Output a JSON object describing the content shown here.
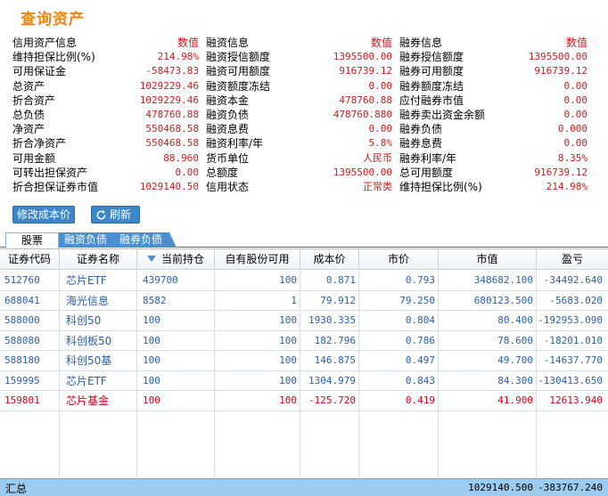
{
  "title": "查询资产",
  "info": {
    "rows": [
      [
        [
          "信用资产信息",
          "数值"
        ],
        [
          "融资信息",
          "数值"
        ],
        [
          "融券信息",
          "数值"
        ]
      ],
      [
        [
          "维持担保比例(%)",
          "214.98%"
        ],
        [
          "融资授信额度",
          "1395500.00"
        ],
        [
          "融券授信额度",
          "1395500.00"
        ]
      ],
      [
        [
          "可用保证金",
          "-58473.83"
        ],
        [
          "融资可用额度",
          "916739.12"
        ],
        [
          "融券可用额度",
          "916739.12"
        ]
      ],
      [
        [
          "总资产",
          "1029229.46"
        ],
        [
          "融资额度冻结",
          "0.00"
        ],
        [
          "融券额度冻结",
          "0.00"
        ]
      ],
      [
        [
          "折合资产",
          "1029229.46"
        ],
        [
          "融资本金",
          "478760.88"
        ],
        [
          "应付融券市值",
          "0.00"
        ]
      ],
      [
        [
          "总负债",
          "478760.88"
        ],
        [
          "融资负债",
          "478760.880"
        ],
        [
          "融券卖出资金余额",
          "0.00"
        ]
      ],
      [
        [
          "净资产",
          "550468.58"
        ],
        [
          "融资息费",
          "0.00"
        ],
        [
          "融券负债",
          "0.000"
        ]
      ],
      [
        [
          "折合净资产",
          "550468.58"
        ],
        [
          "融资利率/年",
          "5.8%"
        ],
        [
          "融券息费",
          "0.00"
        ]
      ],
      [
        [
          "可用金额",
          "88.960"
        ],
        [
          "货币单位",
          "人民币"
        ],
        [
          "融券利率/年",
          "8.35%"
        ]
      ],
      [
        [
          "可转出担保资产",
          "0.00"
        ],
        [
          "总额度",
          "1395500.00"
        ],
        [
          "总可用额度",
          "916739.12"
        ]
      ],
      [
        [
          "折合担保证券市值",
          "1029140.50"
        ],
        [
          "信用状态",
          "正常类"
        ],
        [
          "维持担保比例(%)",
          "214.98%"
        ]
      ]
    ]
  },
  "buttons": {
    "edit_cost": "修改成本价",
    "refresh": "刷新"
  },
  "tabs": [
    "股票",
    "融资负债",
    "融券负债"
  ],
  "table": {
    "headers": [
      "证券代码",
      "证券名称",
      "当前持仓",
      "自有股份可用",
      "成本价",
      "市价",
      "市值",
      "盈亏"
    ],
    "rows": [
      [
        "512760",
        "芯片ETF",
        "439700",
        "100",
        "0.871",
        "0.793",
        "348682.100",
        "-34492.640"
      ],
      [
        "688041",
        "海光信息",
        "8582",
        "1",
        "79.912",
        "79.250",
        "680123.500",
        "-5683.020"
      ],
      [
        "588000",
        "科创50",
        "100",
        "100",
        "1930.335",
        "0.804",
        "80.400",
        "-192953.090"
      ],
      [
        "588080",
        "科创板50",
        "100",
        "100",
        "182.796",
        "0.786",
        "78.600",
        "-18201.010"
      ],
      [
        "588180",
        "科创50基",
        "100",
        "100",
        "146.875",
        "0.497",
        "49.700",
        "-14637.770"
      ],
      [
        "159995",
        "芯片ETF",
        "100",
        "100",
        "1304.979",
        "0.843",
        "84.300",
        "-130413.650"
      ],
      [
        "159801",
        "芯片基金",
        "100",
        "100",
        "-125.720",
        "0.419",
        "41.900",
        "12613.940"
      ]
    ],
    "red_row_index": 6
  },
  "total": {
    "label": "汇总",
    "market_value": "1029140.500",
    "pnl": "-383767.240"
  },
  "colors": {
    "title": "#f0840c",
    "value_red": "#c81e1e",
    "accent_blue": "#3d87c9",
    "row_text_blue": "#2a5fa8",
    "total_bar": "#9dcbee"
  }
}
